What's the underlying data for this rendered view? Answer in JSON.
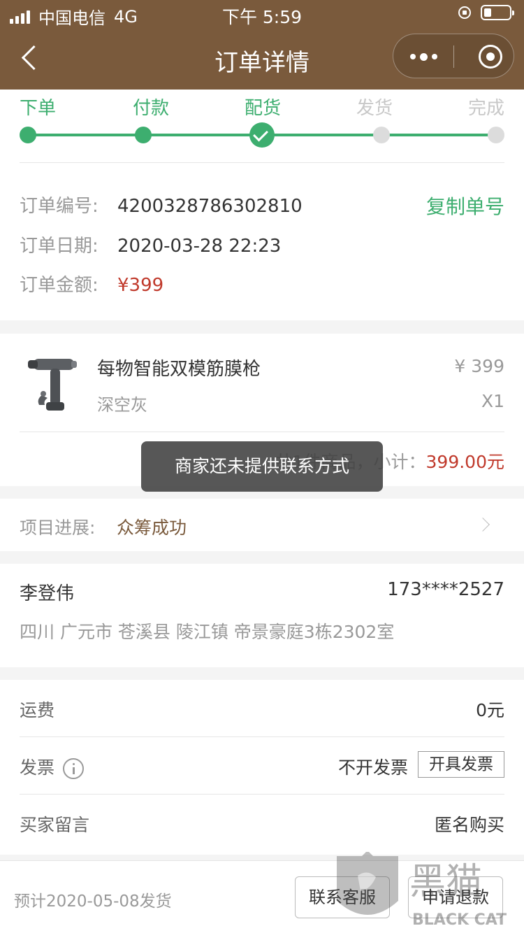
{
  "status_bar": {
    "carrier": "中国电信",
    "network": "4G",
    "time": "下午 5:59"
  },
  "nav": {
    "title": "订单详情",
    "back_icon": "chevron-left-icon",
    "more_icon": "more-dots-icon",
    "close_icon": "target-close-icon"
  },
  "steps": [
    {
      "label": "下单",
      "state": "done"
    },
    {
      "label": "付款",
      "state": "done"
    },
    {
      "label": "配货",
      "state": "current"
    },
    {
      "label": "发货",
      "state": "todo"
    },
    {
      "label": "完成",
      "state": "todo"
    }
  ],
  "colors": {
    "brand": "#7a5a3c",
    "accent": "#3dae6f",
    "price": "#c0392b"
  },
  "order": {
    "number_label": "订单编号:",
    "number": "4200328786302810",
    "copy_label": "复制单号",
    "date_label": "订单日期:",
    "date": "2020-03-28 22:23",
    "amount_label": "订单金额:",
    "amount": "¥399"
  },
  "goods": {
    "name": "每物智能双模筋膜枪",
    "spec": "深空灰",
    "price": "¥ 399",
    "qty": "X1",
    "summary_prefix": "共1件商品，小计：",
    "subtotal": "399.00元"
  },
  "toast": "商家还未提供联系方式",
  "progress": {
    "label": "项目进展:",
    "value": "众筹成功"
  },
  "address": {
    "name": "李登伟",
    "phone": "173****2527",
    "detail": "四川 广元市 苍溪县 陵江镇 帝景豪庭3栋2302室"
  },
  "extras": {
    "shipping_label": "运费",
    "shipping_value": "0元",
    "invoice_label": "发票",
    "invoice_status": "不开发票",
    "invoice_button": "开具发票",
    "note_label": "买家留言",
    "note_value": "匿名购买"
  },
  "bottom": {
    "ship_estimate": "预计2020-05-08发货",
    "contact_button": "联系客服",
    "refund_button": "申请退款"
  },
  "watermark": {
    "cn": "黑猫",
    "en": "BLACK CAT"
  }
}
